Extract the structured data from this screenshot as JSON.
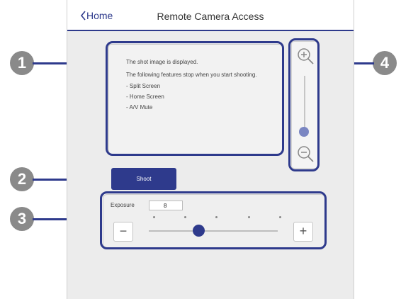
{
  "header": {
    "back_label": "Home",
    "title": "Remote Camera Access"
  },
  "preview": {
    "lines": [
      "The shot image is displayed.",
      "The following features stop when you start shooting.",
      "- Split Screen",
      "- Home Screen",
      "- A/V Mute"
    ]
  },
  "controls": {
    "shoot_label": "Shoot",
    "exposure_label": "Exposure",
    "exposure_value": "8",
    "minus_label": "−",
    "plus_label": "+",
    "zoom_level": 0.1
  },
  "callouts": [
    "1",
    "2",
    "3",
    "4"
  ],
  "colors": {
    "accent": "#2e3a8c",
    "callout": "#8a8a8a"
  },
  "icons": [
    "chevron-left-icon",
    "zoom-in-icon",
    "zoom-out-icon"
  ]
}
